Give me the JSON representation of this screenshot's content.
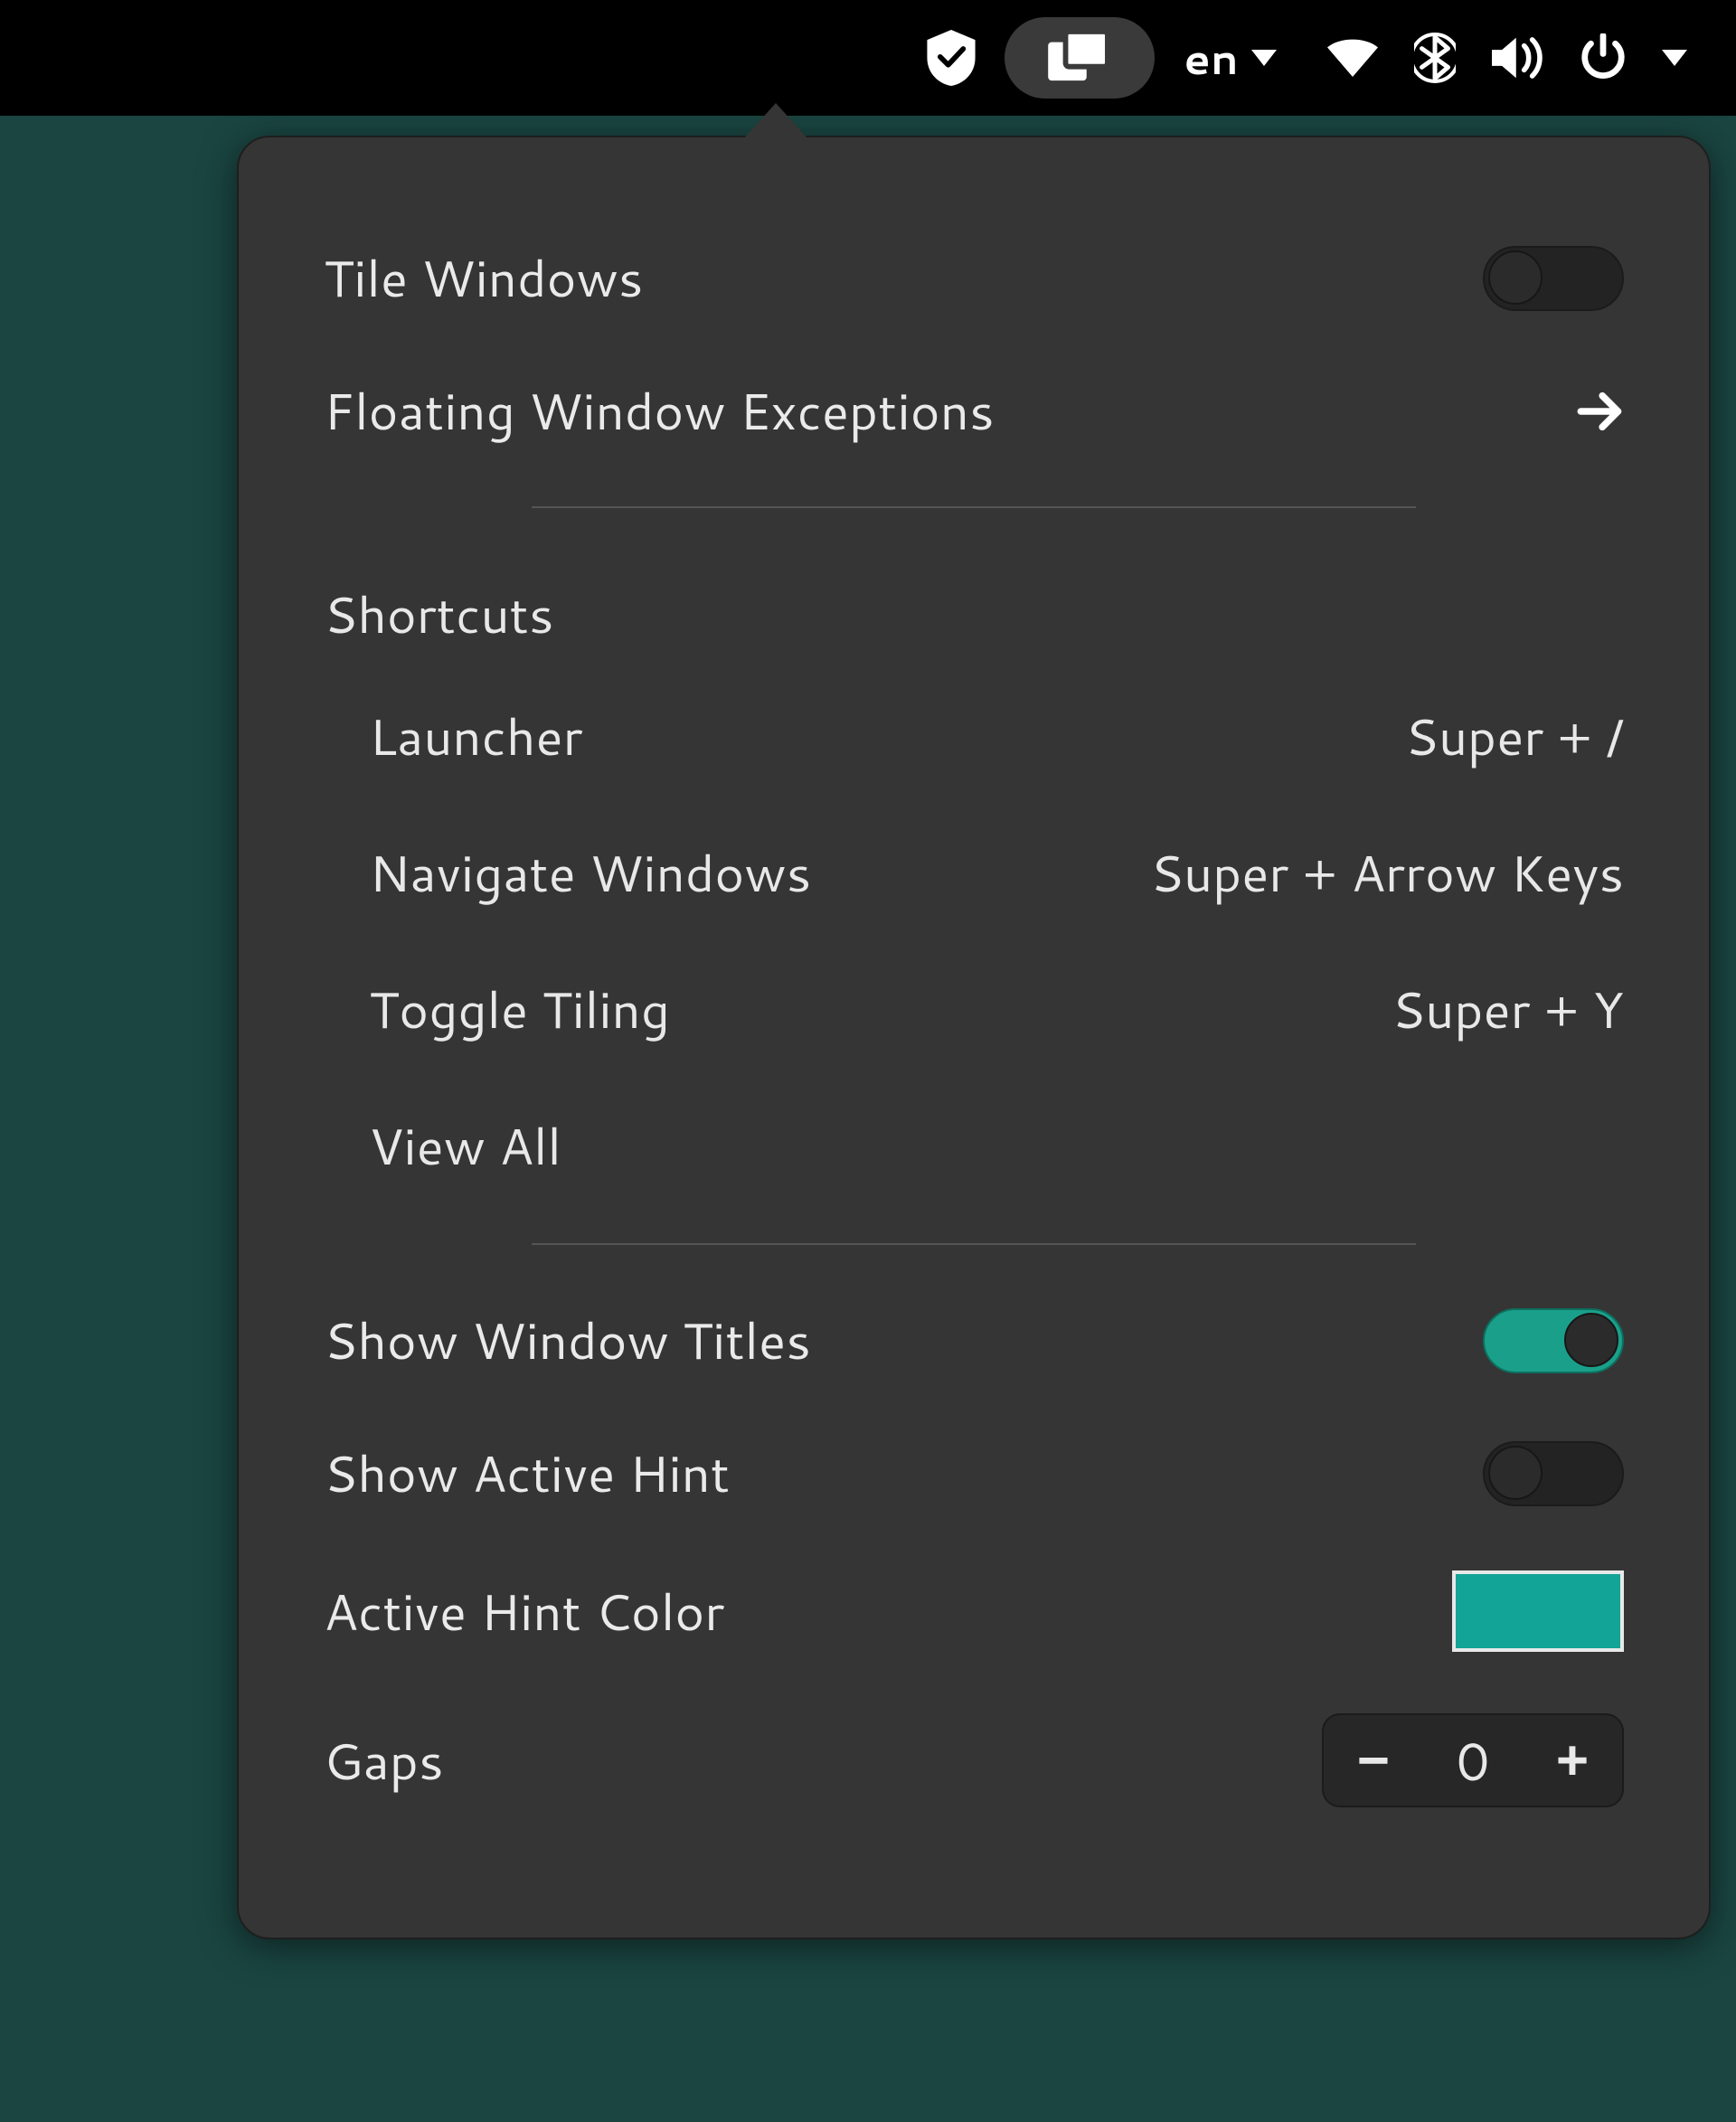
{
  "panel": {
    "language": "en"
  },
  "popover": {
    "tile_windows": {
      "label": "Tile Windows",
      "enabled": false
    },
    "floating_exceptions": {
      "label": "Floating Window Exceptions"
    },
    "shortcuts": {
      "title": "Shortcuts",
      "items": [
        {
          "label": "Launcher",
          "keys": "Super + /"
        },
        {
          "label": "Navigate Windows",
          "keys": "Super + Arrow Keys"
        },
        {
          "label": "Toggle Tiling",
          "keys": "Super + Y"
        }
      ],
      "view_all": "View All"
    },
    "show_window_titles": {
      "label": "Show Window Titles",
      "enabled": true
    },
    "show_active_hint": {
      "label": "Show Active Hint",
      "enabled": false
    },
    "active_hint_color": {
      "label": "Active Hint Color",
      "value": "#12a497"
    },
    "gaps": {
      "label": "Gaps",
      "value": "0",
      "minus": "−",
      "plus": "+"
    }
  },
  "colors": {
    "accent": "#1aa08a"
  }
}
